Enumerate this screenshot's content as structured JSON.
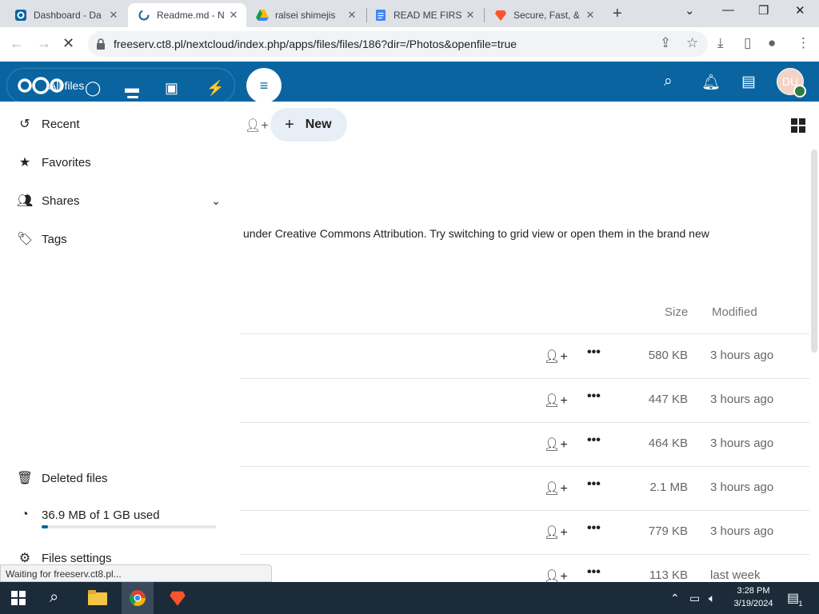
{
  "browser": {
    "tabs": [
      {
        "title": "Dashboard - Da",
        "active": false
      },
      {
        "title": "Readme.md - N",
        "active": true
      },
      {
        "title": "ralsei shimejis",
        "active": false
      },
      {
        "title": "READ ME FIRST",
        "active": false
      },
      {
        "title": "Secure, Fast, &",
        "active": false
      }
    ],
    "url": "freeserv.ct8.pl/nextcloud/index.php/apps/files/files/186?dir=/Photos&openfile=true",
    "status_text": "Waiting for freeserv.ct8.pl..."
  },
  "header": {
    "app_label": "All files",
    "avatar_initials": "DU"
  },
  "sidebar": {
    "items": [
      {
        "label": "Recent",
        "icon": "history-icon"
      },
      {
        "label": "Favorites",
        "icon": "star-icon"
      },
      {
        "label": "Shares",
        "icon": "share-icon"
      },
      {
        "label": "Tags",
        "icon": "tag-icon"
      }
    ],
    "deleted_label": "Deleted files",
    "quota_label": "36.9 MB of 1 GB used",
    "quota_fraction": 0.036,
    "settings_label": "Files settings"
  },
  "toolbar": {
    "new_label": "New"
  },
  "readme": {
    "text": "under Creative Commons Attribution. Try switching to grid view or open them in the brand new"
  },
  "table": {
    "columns": {
      "size": "Size",
      "modified": "Modified"
    },
    "rows": [
      {
        "size": "580 KB",
        "modified": "3 hours ago"
      },
      {
        "size": "447 KB",
        "modified": "3 hours ago"
      },
      {
        "size": "464 KB",
        "modified": "3 hours ago"
      },
      {
        "size": "2.1 MB",
        "modified": "3 hours ago"
      },
      {
        "size": "779 KB",
        "modified": "3 hours ago"
      },
      {
        "size": "113 KB",
        "modified": "last week"
      }
    ]
  },
  "taskbar": {
    "time": "3:28 PM",
    "date": "3/19/2024",
    "notification_count": "1"
  },
  "colors": {
    "brand": "#0a64a0"
  }
}
